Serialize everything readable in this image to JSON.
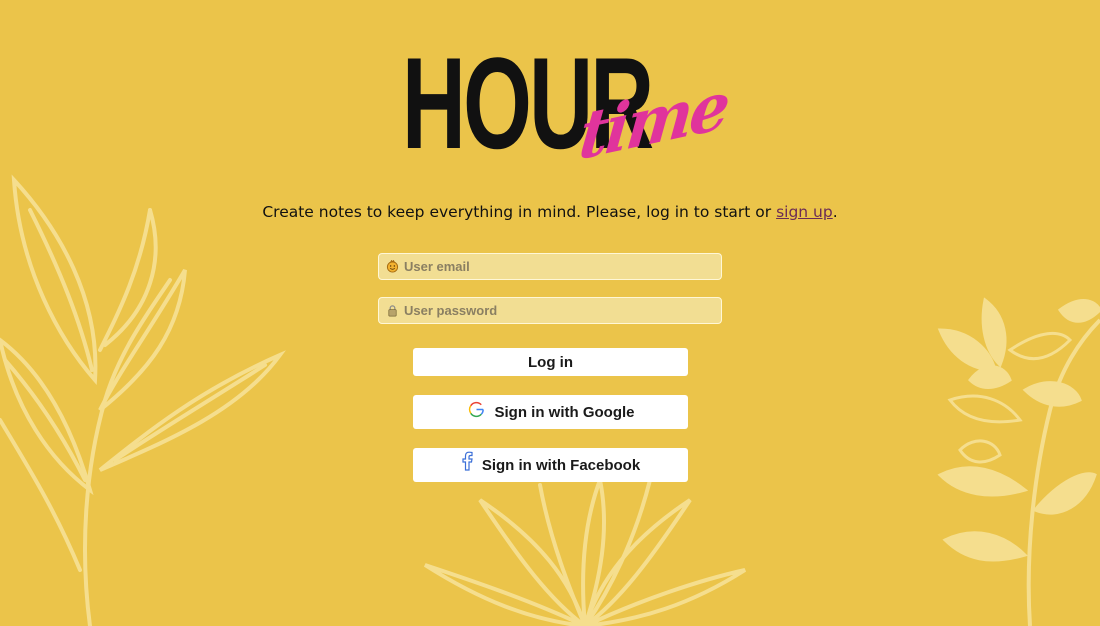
{
  "logo": {
    "word1": "HOUR",
    "word2": "time"
  },
  "tagline": {
    "text": "Create notes to keep everything in mind. Please, log in to start or ",
    "link": "sign up",
    "suffix": "."
  },
  "email": {
    "placeholder": "User email",
    "icon": "smiley-icon"
  },
  "password": {
    "placeholder": "User password",
    "icon": "lock-icon"
  },
  "buttons": {
    "login": "Log in",
    "google": "Sign in with Google",
    "facebook": "Sign in with Facebook"
  },
  "colors": {
    "background": "#EBC44A",
    "accent": "#E0349C",
    "link": "#6B2C55",
    "leaf": "#F5E08F"
  }
}
